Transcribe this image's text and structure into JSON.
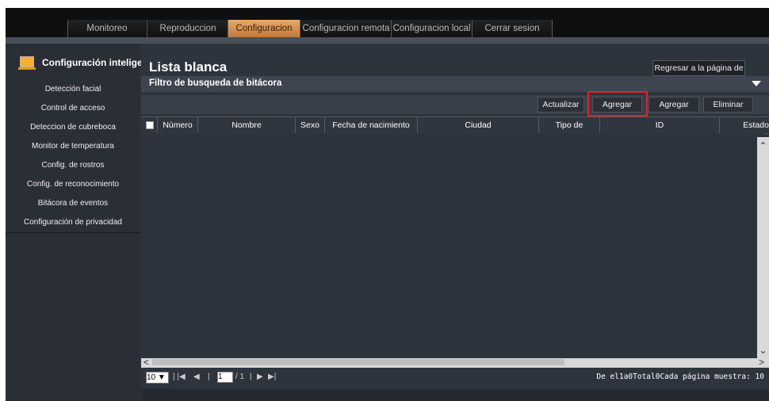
{
  "nav": {
    "tabs": [
      "Monitoreo",
      "Reproduccion",
      "Configuracion",
      "Configuracion remota",
      "Configuracion local",
      "Cerrar sesion"
    ],
    "active_tab": "Configuracion"
  },
  "sidebar": {
    "header": "Configuración inteligente",
    "items": [
      {
        "label": "Detección facial"
      },
      {
        "label": "Control de acceso"
      },
      {
        "label": "Deteccion de cubreboca"
      },
      {
        "label": "Monitor de temperatura"
      },
      {
        "label": "Config. de rostros"
      },
      {
        "label": "Config. de reconocimiento"
      },
      {
        "label": "Bitácora de eventos"
      },
      {
        "label": "Configuración de privacidad"
      }
    ]
  },
  "main": {
    "title": "Lista blanca",
    "back_button": "Regresar a la página de",
    "filter_label": "Filtro de busqueda de bitácora",
    "toolbar": {
      "refresh": "Actualizar",
      "add_1": "Agregar",
      "add_2": "Agregar",
      "delete": "Eliminar"
    },
    "columns": [
      "Número",
      "Nombre",
      "Sexo",
      "Fecha de nacimiento",
      "Ciudad",
      "Tipo de",
      "ID",
      "Estado"
    ],
    "rows": []
  },
  "pager": {
    "page_size": "10",
    "current_page": "1",
    "total_pages": "/ 1",
    "summary": "De el1a0Total0Cada página muestra: 10"
  },
  "colors": {
    "accent_tab": "#d9955a",
    "highlight_border": "#e0242a"
  }
}
